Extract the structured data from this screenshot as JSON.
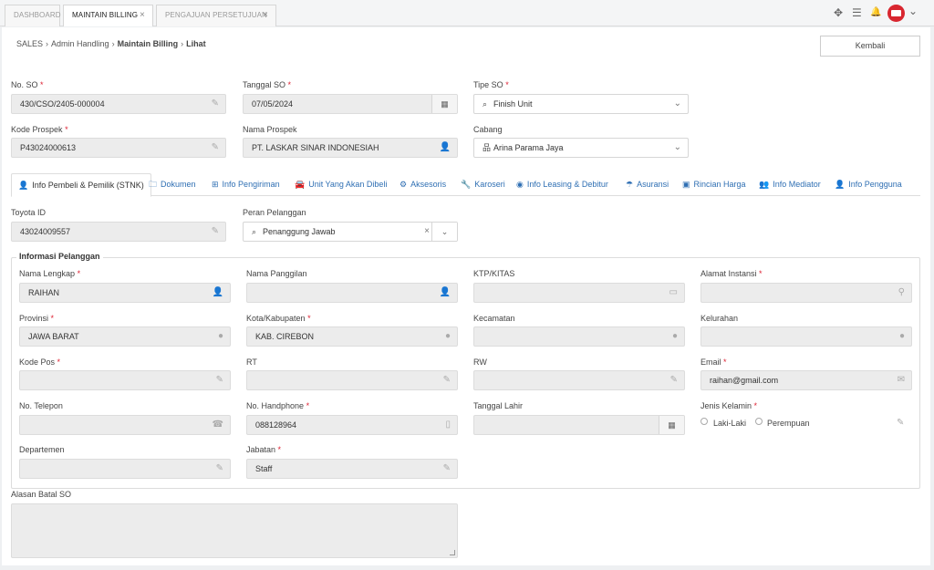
{
  "top_tabs": {
    "dashboard": "DASHBOARD",
    "maintain_billing": "MAINTAIN BILLING",
    "pengajuan": "PENGAJUAN PERSETUJUAN",
    "close": "×"
  },
  "top_icons": {
    "expand": "✥",
    "menu": "☰",
    "bell": "🔔",
    "caret": "⌄"
  },
  "breadcrumb": {
    "sales": "SALES",
    "admin": "Admin Handling",
    "billing": "Maintain Billing",
    "lihat": "Lihat",
    "sep": "›"
  },
  "back_button": "Kembali",
  "required": "*",
  "form": {
    "no_so": {
      "label": "No. SO",
      "value": "430/CSO/2405-000004"
    },
    "tanggal_so": {
      "label": "Tanggal SO",
      "value": "07/05/2024"
    },
    "tipe_so": {
      "label": "Tipe SO",
      "value": "Finish Unit"
    },
    "kode_prospek": {
      "label": "Kode Prospek",
      "value": "P43024000613"
    },
    "nama_prospek": {
      "label": "Nama Prospek",
      "value": "PT. LASKAR SINAR INDONESIAH"
    },
    "cabang": {
      "label": "Cabang",
      "value": "Arina Parama Jaya"
    }
  },
  "section_tabs": [
    {
      "icon": "user-icon",
      "glyph": "👤",
      "label": "Info Pembeli & Pemilik (STNK)"
    },
    {
      "icon": "folder-icon",
      "glyph": "🗀",
      "label": "Dokumen"
    },
    {
      "icon": "map-icon",
      "glyph": "⊞",
      "label": "Info Pengiriman"
    },
    {
      "icon": "car-icon",
      "glyph": "🚘",
      "label": "Unit Yang Akan Dibeli"
    },
    {
      "icon": "gears-icon",
      "glyph": "⚙",
      "label": "Aksesoris"
    },
    {
      "icon": "wrench-icon",
      "glyph": "🔧",
      "label": "Karoseri"
    },
    {
      "icon": "eye-icon",
      "glyph": "◉",
      "label": "Info Leasing & Debitur"
    },
    {
      "icon": "umbrella-icon",
      "glyph": "☂",
      "label": "Asuransi"
    },
    {
      "icon": "money-icon",
      "glyph": "▣",
      "label": "Rincian Harga"
    },
    {
      "icon": "users-icon",
      "glyph": "👥",
      "label": "Info Mediator"
    },
    {
      "icon": "user-icon",
      "glyph": "👤",
      "label": "Info Pengguna"
    }
  ],
  "toyota_id": {
    "label": "Toyota ID",
    "value": "43024009557"
  },
  "peran_pelanggan": {
    "label": "Peran Pelanggan",
    "value": "Penanggung Jawab",
    "clear": "×",
    "caret": "⌄"
  },
  "informasi_pelanggan": {
    "legend": "Informasi Pelanggan",
    "nama_lengkap": {
      "label": "Nama Lengkap",
      "value": "RAIHAN"
    },
    "nama_panggilan": {
      "label": "Nama Panggilan",
      "value": ""
    },
    "ktp": {
      "label": "KTP/KITAS",
      "value": ""
    },
    "alamat_instansi": {
      "label": "Alamat Instansi",
      "value": ""
    },
    "provinsi": {
      "label": "Provinsi",
      "value": "JAWA BARAT"
    },
    "kota": {
      "label": "Kota/Kabupaten",
      "value": "KAB. CIREBON"
    },
    "kecamatan": {
      "label": "Kecamatan",
      "value": ""
    },
    "kelurahan": {
      "label": "Kelurahan",
      "value": ""
    },
    "kode_pos": {
      "label": "Kode Pos",
      "value": ""
    },
    "rt": {
      "label": "RT",
      "value": ""
    },
    "rw": {
      "label": "RW",
      "value": ""
    },
    "email": {
      "label": "Email",
      "value": "raihan@gmail.com"
    },
    "no_telepon": {
      "label": "No. Telepon",
      "value": ""
    },
    "no_handphone": {
      "label": "No. Handphone",
      "value": "088128964"
    },
    "tanggal_lahir": {
      "label": "Tanggal Lahir",
      "value": ""
    },
    "jenis_kelamin": {
      "label": "Jenis Kelamin",
      "options": [
        "Laki-Laki",
        "Perempuan"
      ]
    },
    "departemen": {
      "label": "Departemen",
      "value": ""
    },
    "jabatan": {
      "label": "Jabatan",
      "value": "Staff"
    }
  },
  "alasan_batal": {
    "label": "Alasan Batal SO",
    "value": ""
  },
  "glyphs": {
    "pencil": "✎",
    "calendar": "▦",
    "search": "⌕",
    "caret": "⌄",
    "user": "👤",
    "globe": "●",
    "pin": "⚲",
    "id_card": "▭",
    "envelope": "✉",
    "phone": "☎",
    "mobile": "▯",
    "sitemap": "品"
  },
  "colors": {
    "link": "#2f6fb3",
    "required": "#d23",
    "avatar": "#d8262f"
  }
}
